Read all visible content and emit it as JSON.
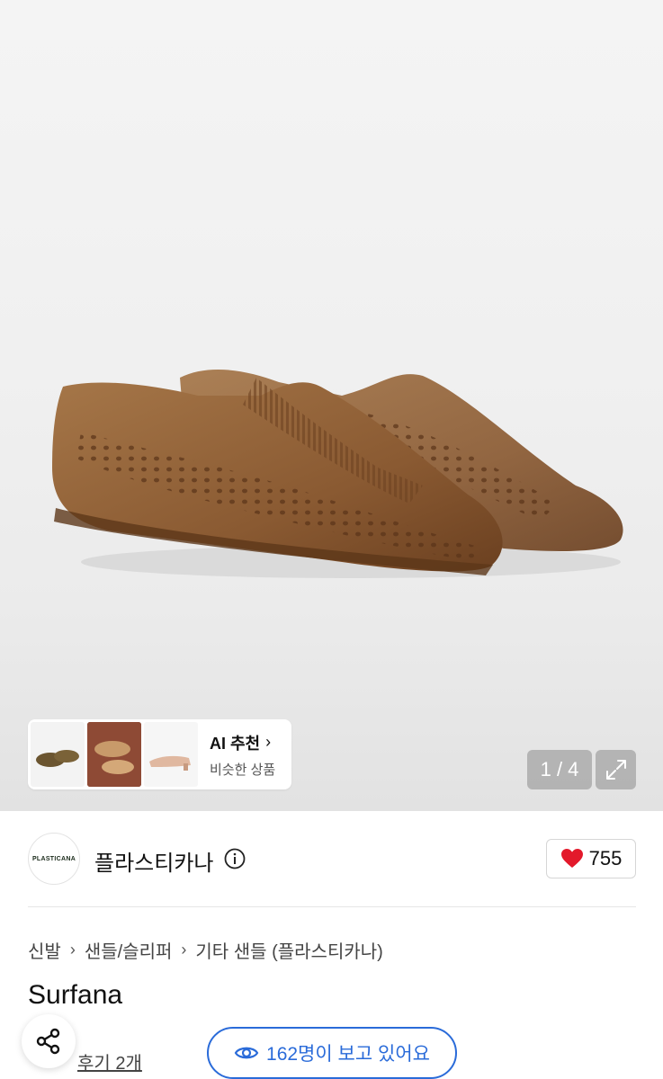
{
  "gallery": {
    "counter": "1 / 4",
    "ai_card": {
      "title": "AI 추천",
      "subtitle": "비슷한 상품"
    }
  },
  "brand": {
    "logo_text": "PLASTICANA",
    "name": "플라스티카나",
    "likes": "755"
  },
  "breadcrumb": [
    "신발",
    "샌들/슬리퍼",
    "기타 샌들 (플라스티카나)"
  ],
  "product": {
    "title": "Surfana",
    "reviews": "후기 2개",
    "viewers": "162명이 보고 있어요"
  },
  "colors": {
    "accent_blue": "#2a6bd9",
    "heart_red": "#e3192b",
    "shoe_brown": "#8a5a32"
  }
}
